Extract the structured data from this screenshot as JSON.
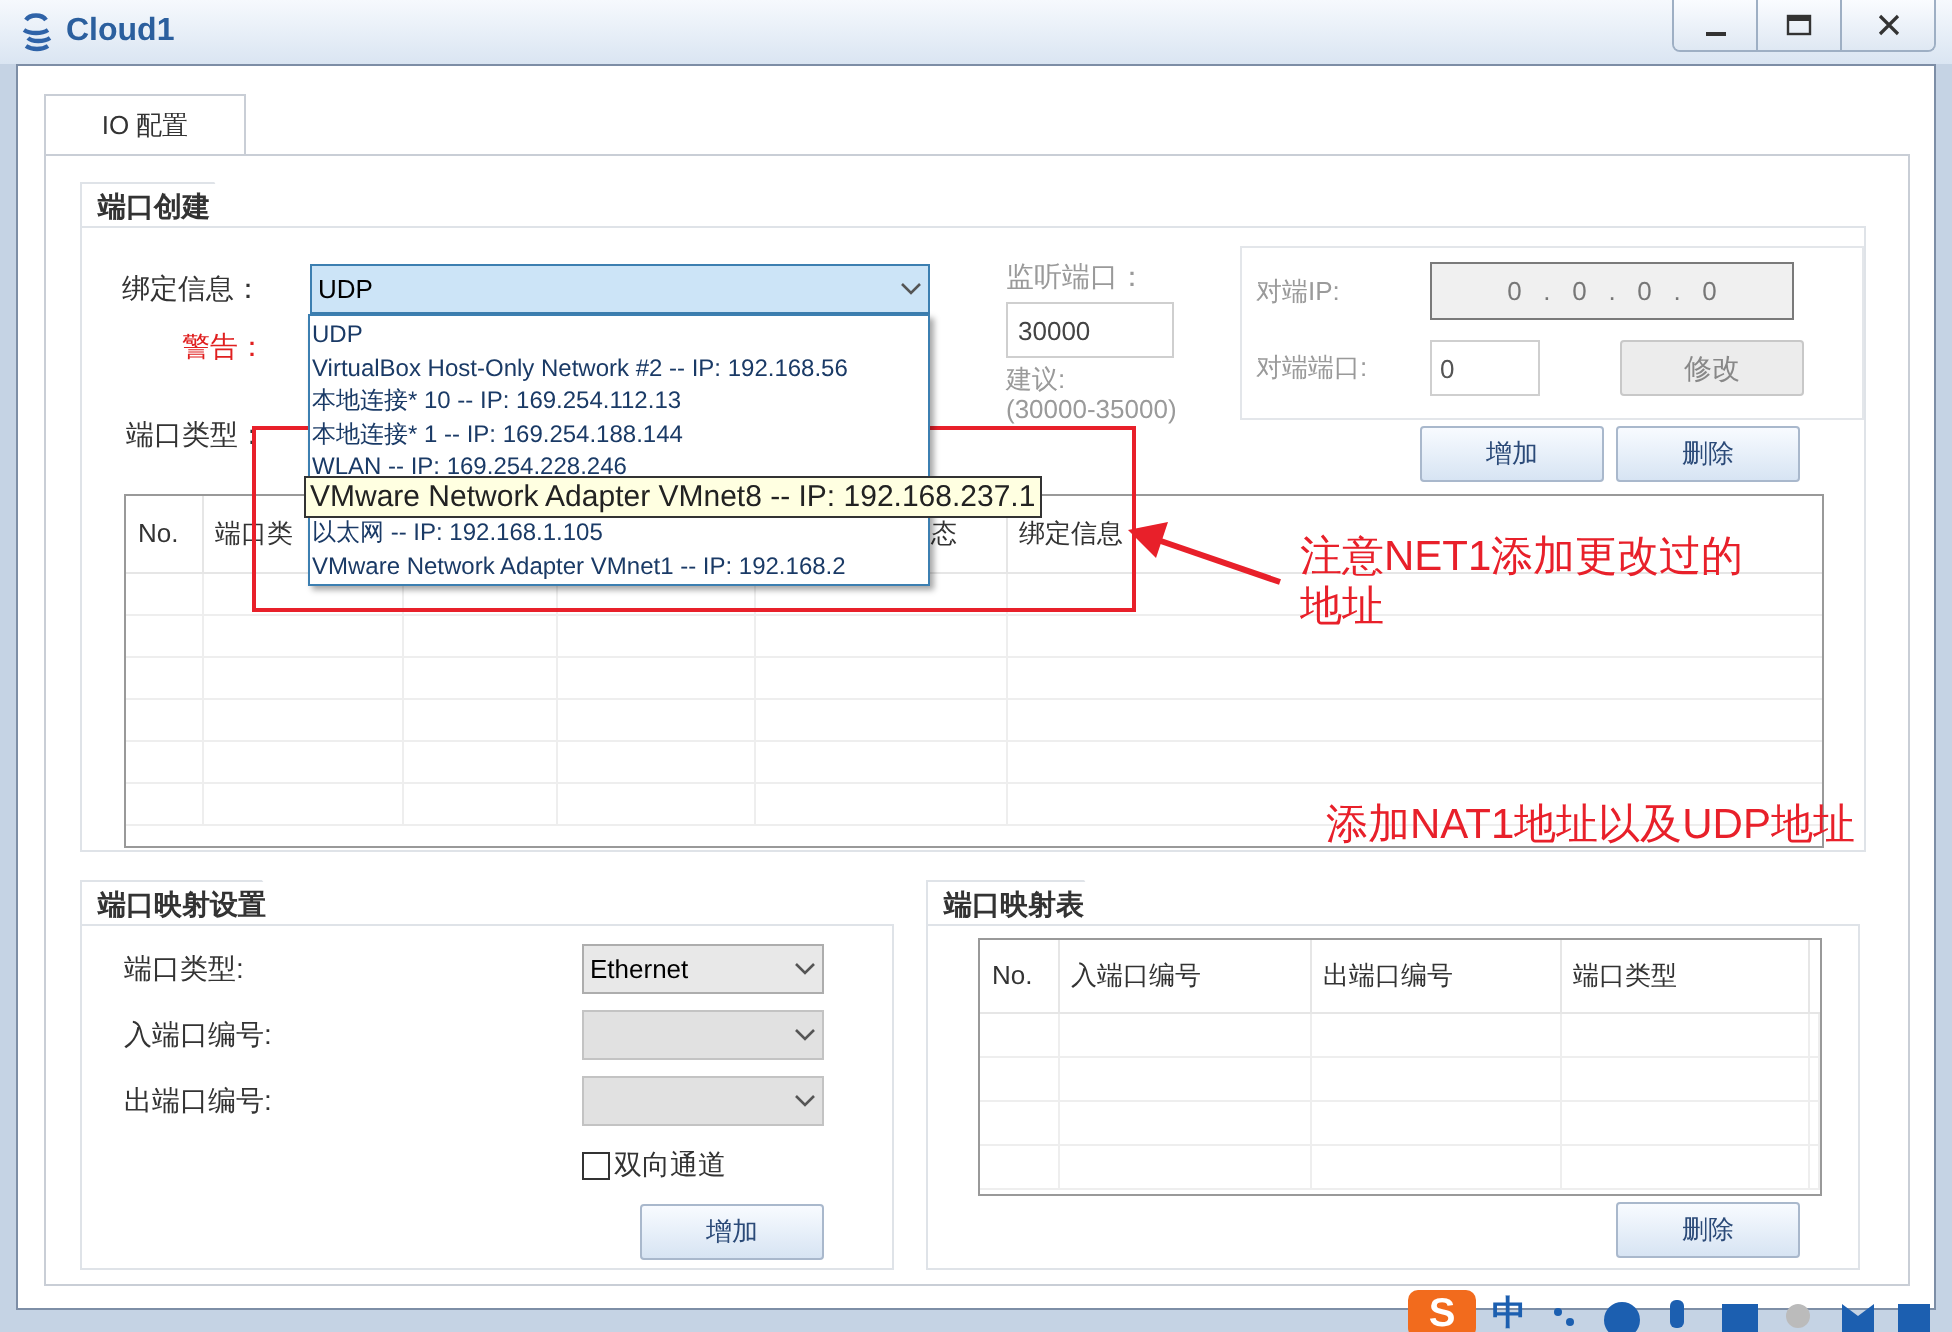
{
  "window": {
    "title": "Cloud1"
  },
  "tabs": [
    {
      "label": "IO 配置",
      "selected": true
    }
  ],
  "port_create": {
    "title": "端口创建",
    "bind_label": "绑定信息：",
    "bind_combo": {
      "value": "UDP",
      "open": true,
      "items": [
        {
          "label": "UDP",
          "hovered": false
        },
        {
          "label": "VirtualBox Host-Only Network #2 -- IP: 192.168.56",
          "hovered": false
        },
        {
          "label": "本地连接* 10 -- IP: 169.254.112.13",
          "hovered": false
        },
        {
          "label": "本地连接* 1 -- IP: 169.254.188.144",
          "hovered": false
        },
        {
          "label": "WLAN -- IP: 169.254.228.246",
          "hovered": false
        },
        {
          "label": "VMware Network Adapter VMnet8 -- IP: 192.168.237.1",
          "hovered": true
        },
        {
          "label": "以太网 -- IP: 192.168.1.105",
          "hovered": false
        },
        {
          "label": "VMware Network Adapter VMnet1 -- IP: 192.168.2",
          "hovered": false
        }
      ]
    },
    "warning_label": "警告：",
    "port_type_label": "端口类型：",
    "listen_port": {
      "label": "监听端口：",
      "value": "30000",
      "hint": "建议:",
      "range": "(30000-35000)",
      "disabled": true
    },
    "peer": {
      "disabled": true,
      "ip_label": "对端IP:",
      "ip_value": "0   .   0   .   0   .   0",
      "port_label": "对端端口:",
      "port_value": "0",
      "modify_button": "修改"
    },
    "buttons": [
      "增加",
      "删除"
    ],
    "table": {
      "columns": [
        "No.",
        "端口类",
        "",
        "",
        "态",
        "绑定信息"
      ]
    }
  },
  "mapping_settings": {
    "title": "端口映射设置",
    "rows": [
      {
        "label": "端口类型:",
        "value": "Ethernet",
        "disabled": false
      },
      {
        "label": "入端口编号:",
        "value": "",
        "disabled": true
      },
      {
        "label": "出端口编号:",
        "value": "",
        "disabled": true
      }
    ],
    "bidirectional": {
      "label": "双向通道",
      "checked": false
    },
    "add_button": "增加"
  },
  "mapping_table": {
    "title": "端口映射表",
    "columns": [
      "No.",
      "入端口编号",
      "出端口编号",
      "端口类型"
    ],
    "delete_button": "删除"
  },
  "annotations": [
    {
      "text": "注意NET1添加更改过的地址"
    },
    {
      "text": "添加NAT1地址以及UDP地址"
    }
  ],
  "ime": {
    "logo": "S",
    "mode": "中"
  }
}
